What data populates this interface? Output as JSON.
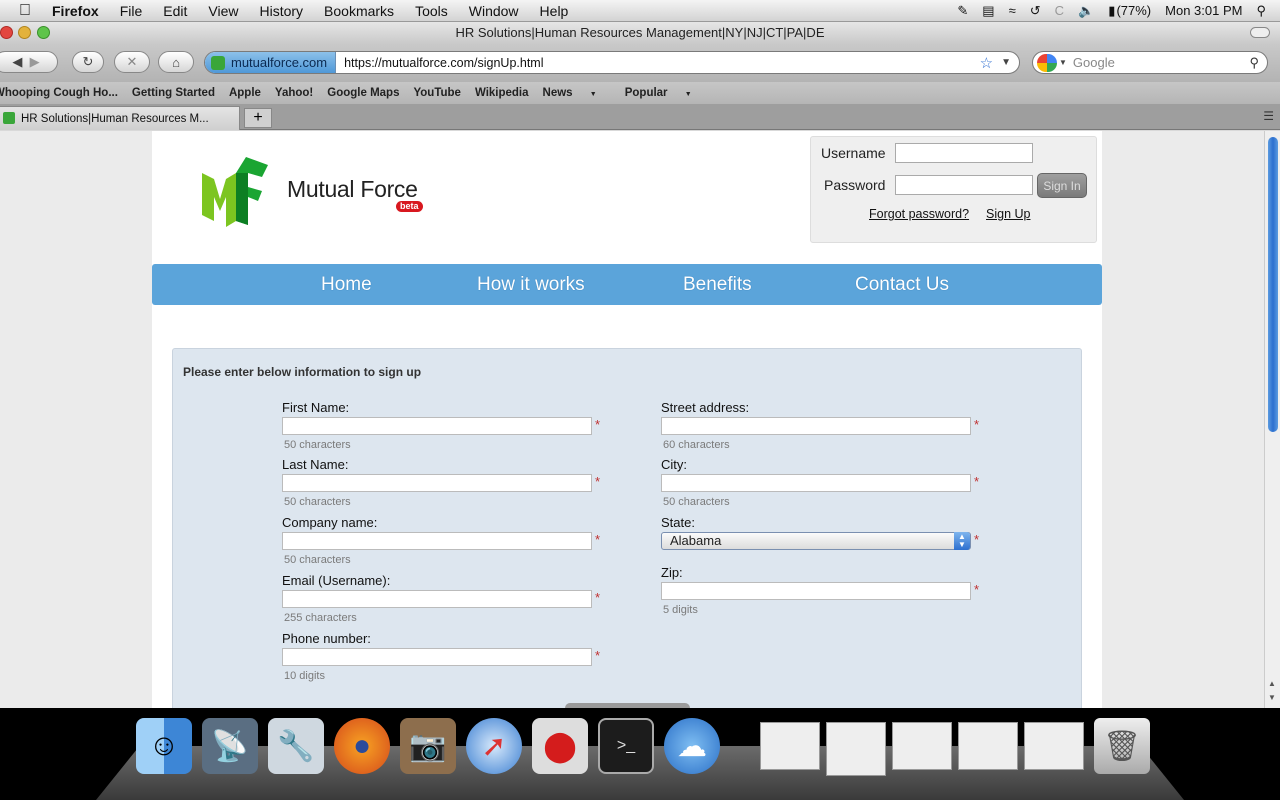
{
  "menubar": {
    "app": "Firefox",
    "items": [
      "File",
      "Edit",
      "View",
      "History",
      "Bookmarks",
      "Tools",
      "Window",
      "Help"
    ],
    "battery": "(77%)",
    "clock": "Mon 3:01 PM"
  },
  "window": {
    "title": "HR Solutions|Human Resources Management|NY|NJ|CT|PA|DE"
  },
  "toolbar": {
    "site_identity": "mutualforce.com",
    "url": "https://mutualforce.com/signUp.html",
    "search_placeholder": "Google"
  },
  "bookmarks": [
    "Whooping Cough Ho...",
    "Getting Started",
    "Apple",
    "Yahoo!",
    "Google Maps",
    "YouTube",
    "Wikipedia",
    "News",
    "Popular"
  ],
  "tab": {
    "title": "HR Solutions|Human Resources M..."
  },
  "site": {
    "logo_text": "Mutual Force",
    "beta": "beta",
    "login": {
      "username_label": "Username",
      "password_label": "Password",
      "signin": "Sign In",
      "forgot": "Forgot password?",
      "signup": "Sign Up"
    },
    "nav": [
      "Home",
      "How it works",
      "Benefits",
      "Contact Us"
    ]
  },
  "form": {
    "title": "Please enter below information to sign up",
    "left": [
      {
        "label": "First Name:",
        "hint": "50 characters"
      },
      {
        "label": "Last Name:",
        "hint": "50 characters"
      },
      {
        "label": "Company name:",
        "hint": "50 characters"
      },
      {
        "label": "Email (Username):",
        "hint": "255 characters"
      },
      {
        "label": "Phone number:",
        "hint": "10 digits"
      }
    ],
    "right": [
      {
        "label": "Street address:",
        "hint": "60 characters"
      },
      {
        "label": "City:",
        "hint": "50 characters"
      },
      {
        "label": "State:",
        "value": "Alabama"
      },
      {
        "label": "Zip:",
        "hint": "5 digits"
      }
    ],
    "required_mark": "*"
  },
  "colors": {
    "nav_bg": "#5ba4da",
    "form_bg": "#dde6ef",
    "required": "#c03030",
    "beta_badge": "#d8181f"
  }
}
